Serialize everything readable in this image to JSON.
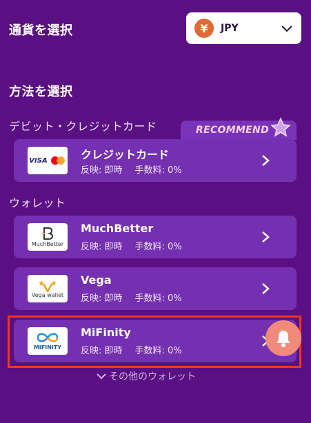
{
  "header": {
    "currency_title": "通貨を選択",
    "currency_symbol": "¥",
    "currency_code": "JPY",
    "method_title": "方法を選択"
  },
  "sections": {
    "card_label": "デビット・クレジットカード",
    "wallet_label": "ウォレット",
    "recommend_label": "RECOMMEND"
  },
  "methods": [
    {
      "name": "クレジットカード",
      "reflect": "反映: 即時",
      "fee": "手数料: 0%",
      "logo_text": "VISA"
    },
    {
      "name": "MuchBetter",
      "reflect": "反映: 即時",
      "fee": "手数料: 0%",
      "logo_text": "MuchBetter"
    },
    {
      "name": "Vega",
      "reflect": "反映: 即時",
      "fee": "手数料: 0%",
      "logo_text": "Vega wallet"
    },
    {
      "name": "MiFinity",
      "reflect": "反映: 即時",
      "fee": "手数料: 0%",
      "logo_text": "MIFINITY"
    }
  ],
  "more_wallets": "その他のウォレット",
  "colors": {
    "background": "#5a1083",
    "card": "#7430b0",
    "highlight": "#e8372a",
    "bell": "#f08b7b",
    "yen": "#e06a35"
  }
}
